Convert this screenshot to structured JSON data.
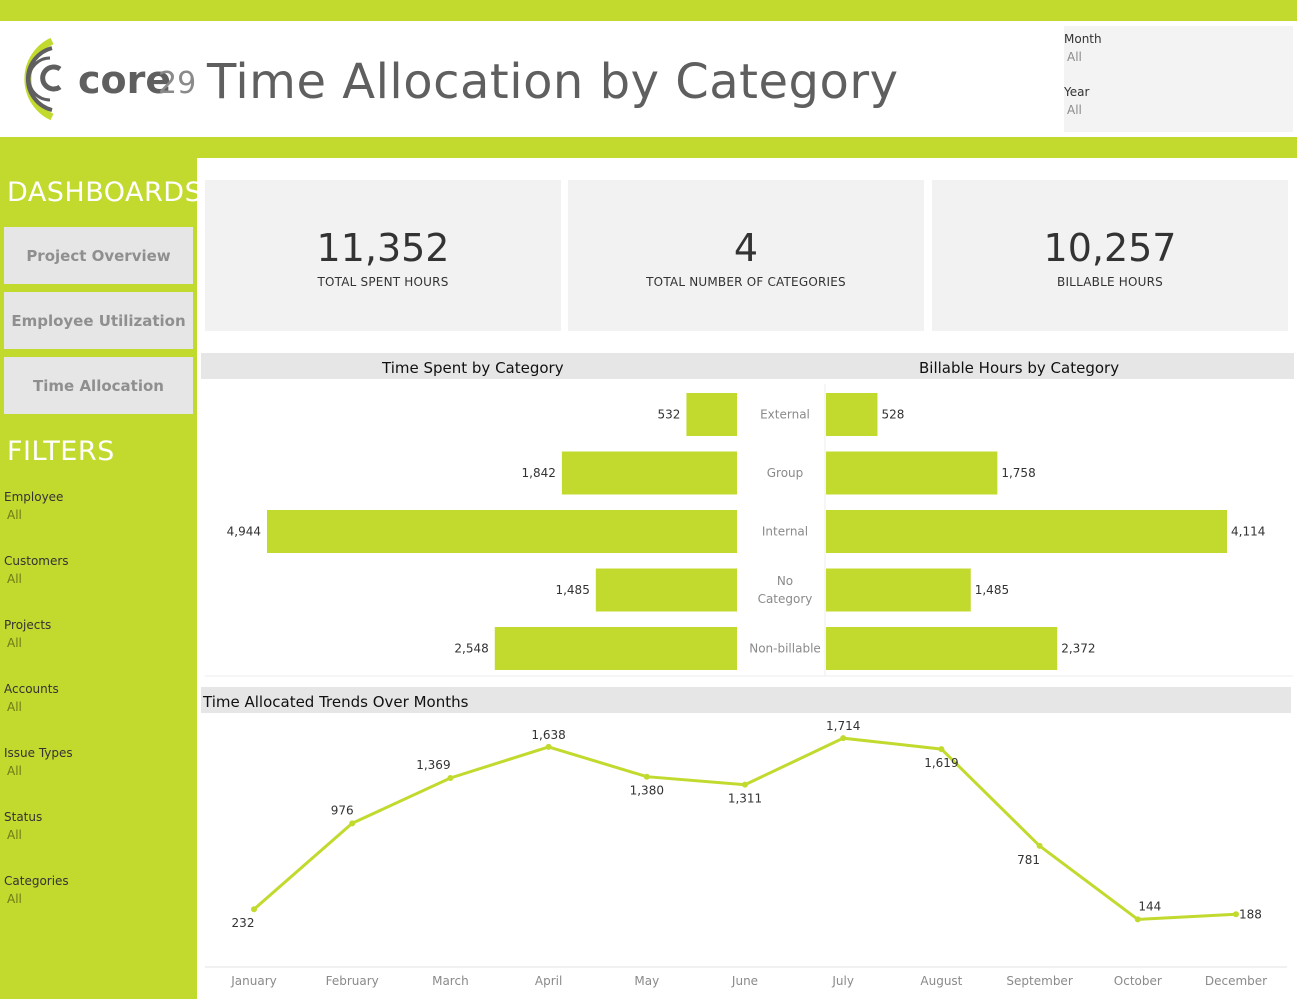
{
  "header": {
    "title": "Time Allocation by Category",
    "logo_text": "core",
    "logo_number": "29"
  },
  "top_filters": [
    {
      "label": "Month",
      "value": "All"
    },
    {
      "label": "Year",
      "value": "All"
    }
  ],
  "sidebar": {
    "dashboards_heading": "DASHBOARDS",
    "nav": [
      {
        "label": "Project Overview"
      },
      {
        "label": "Employee Utilization"
      },
      {
        "label": "Time Allocation"
      }
    ],
    "filters_heading": "FILTERS",
    "filters": [
      {
        "label": "Employee",
        "value": "All"
      },
      {
        "label": "Customers",
        "value": "All"
      },
      {
        "label": "Projects",
        "value": "All"
      },
      {
        "label": "Accounts",
        "value": "All"
      },
      {
        "label": "Issue Types",
        "value": "All"
      },
      {
        "label": "Status",
        "value": "All"
      },
      {
        "label": "Categories",
        "value": "All"
      }
    ]
  },
  "kpis": [
    {
      "value": "11,352",
      "label": "TOTAL SPENT HOURS"
    },
    {
      "value": "4",
      "label": "TOTAL NUMBER OF CATEGORIES"
    },
    {
      "value": "10,257",
      "label": "BILLABLE HOURS"
    }
  ],
  "colors": {
    "accent": "#c2d92e",
    "panel": "#f2f2f2",
    "header_gray": "#e6e6e6"
  },
  "chart_data": [
    {
      "type": "bar",
      "title": "Time Spent by Category",
      "orientation": "horizontal",
      "direction": "right-to-left",
      "categories": [
        "External",
        "Group",
        "Internal",
        "No Category",
        "Non-billable"
      ],
      "category_display": [
        [
          "External"
        ],
        [
          "Group"
        ],
        [
          "Internal"
        ],
        [
          "No",
          "Category"
        ],
        [
          "Non-billable"
        ]
      ],
      "values": [
        532,
        1842,
        4944,
        1485,
        2548
      ],
      "value_labels": [
        "532",
        "1,842",
        "4,944",
        "1,485",
        "2,548"
      ],
      "xlim": [
        0,
        5200
      ]
    },
    {
      "type": "bar",
      "title": "Billable Hours by Category",
      "orientation": "horizontal",
      "categories": [
        "External",
        "Group",
        "Internal",
        "No Category",
        "Non-billable"
      ],
      "values": [
        528,
        1758,
        4114,
        1485,
        2372
      ],
      "value_labels": [
        "528",
        "1,758",
        "4,114",
        "1,485",
        "2,372"
      ],
      "xlim": [
        0,
        4400
      ]
    },
    {
      "type": "line",
      "title": "Time Allocated Trends Over Months",
      "x": [
        "January",
        "February",
        "March",
        "April",
        "May",
        "June",
        "July",
        "August",
        "September",
        "October",
        "December"
      ],
      "values": [
        232,
        976,
        1369,
        1638,
        1380,
        1311,
        1714,
        1619,
        781,
        144,
        188
      ],
      "value_labels": [
        "232",
        "976",
        "1,369",
        "1,638",
        "1,380",
        "1,311",
        "1,714",
        "1,619",
        "781",
        "144",
        "188"
      ],
      "ylim": [
        0,
        1750
      ],
      "grid": false
    }
  ]
}
